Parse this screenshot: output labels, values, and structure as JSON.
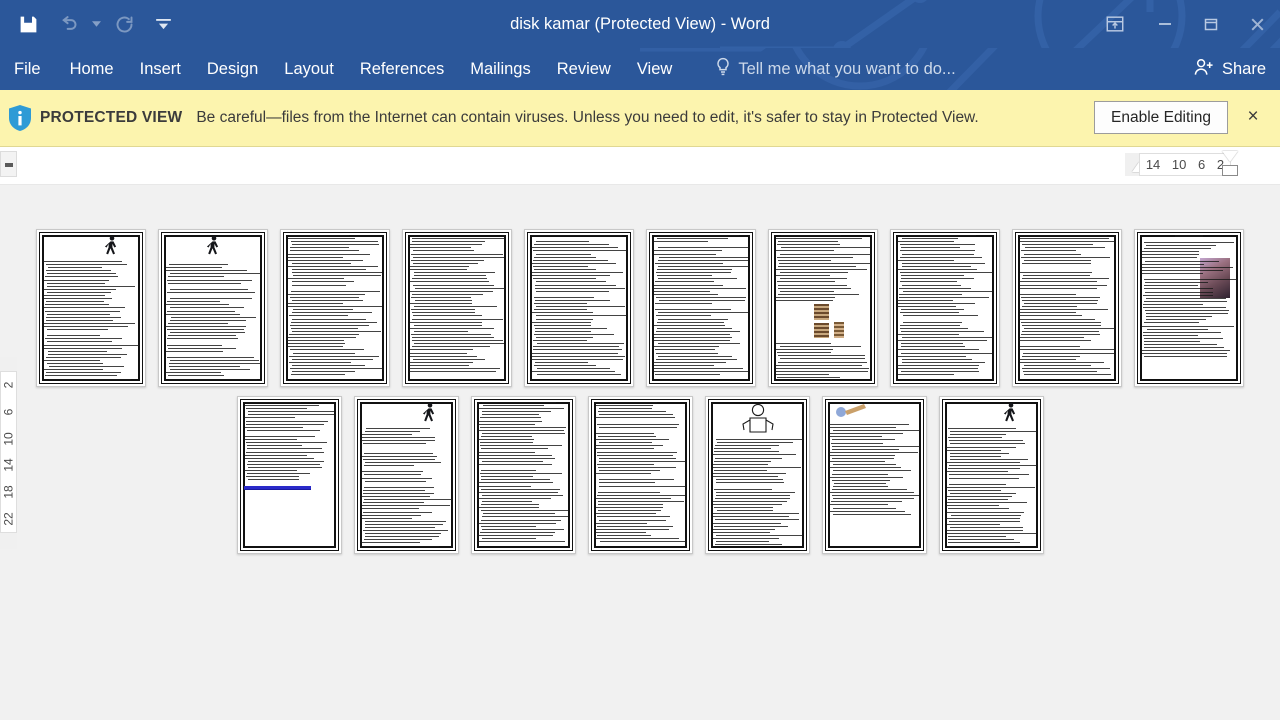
{
  "window": {
    "title": "disk kamar (Protected View) - Word",
    "quick_access": [
      {
        "name": "save-icon",
        "label": "Save",
        "enabled": true
      },
      {
        "name": "undo-icon",
        "label": "Undo",
        "enabled": false
      },
      {
        "name": "redo-icon",
        "label": "Redo",
        "enabled": false
      },
      {
        "name": "customize-quick-access-icon",
        "label": "Customize Quick Access Toolbar",
        "enabled": true
      }
    ],
    "controls": [
      {
        "name": "ribbon-display-options-icon",
        "label": "Ribbon Display Options"
      },
      {
        "name": "minimize-icon",
        "label": "Minimize"
      },
      {
        "name": "restore-icon",
        "label": "Restore Down"
      },
      {
        "name": "close-icon",
        "label": "Close"
      }
    ]
  },
  "ribbon": {
    "tabs": [
      {
        "label": "File"
      },
      {
        "label": "Home"
      },
      {
        "label": "Insert"
      },
      {
        "label": "Design"
      },
      {
        "label": "Layout"
      },
      {
        "label": "References"
      },
      {
        "label": "Mailings"
      },
      {
        "label": "Review"
      },
      {
        "label": "View"
      }
    ],
    "tell_me_placeholder": "Tell me what you want to do...",
    "share_label": "Share"
  },
  "protected_view": {
    "label": "PROTECTED VIEW",
    "message": "Be careful—files from the Internet can contain viruses. Unless you need to edit, it's safer to stay in Protected",
    "message_line2": "View.",
    "enable_button": "Enable Editing",
    "close_label": "×",
    "info_icon": "shield-info-icon",
    "bg_color": "#fcf4ae"
  },
  "rulers": {
    "horizontal_ticks": [
      "14",
      "10",
      "6",
      "2"
    ],
    "vertical_ticks": [
      "2",
      "6",
      "10",
      "14",
      "18",
      "22"
    ]
  },
  "theme": {
    "titlebar": "#2b579a",
    "canvas": "#f1f1f1",
    "accent": "#2b579a",
    "link": "#2a2aca"
  },
  "document": {
    "zoom_view": "multiple-pages",
    "row1_pages": [
      {
        "page": 1,
        "art": "horse-illustration"
      },
      {
        "page": 2,
        "art": "figure-illustration"
      },
      {
        "page": 3,
        "art": "none"
      },
      {
        "page": 4,
        "art": "none"
      },
      {
        "page": 5,
        "art": "none"
      },
      {
        "page": 6,
        "art": "none"
      },
      {
        "page": 7,
        "art": "spine-diagram"
      },
      {
        "page": 8,
        "art": "none"
      },
      {
        "page": 9,
        "art": "none"
      },
      {
        "page": 10,
        "art": "back-pain-photo"
      }
    ],
    "row2_pages": [
      {
        "page": 11,
        "art": "hyperlink"
      },
      {
        "page": 12,
        "art": "running-figure"
      },
      {
        "page": 13,
        "art": "none"
      },
      {
        "page": 14,
        "art": "none"
      },
      {
        "page": 15,
        "art": "exercise-figure"
      },
      {
        "page": 16,
        "art": "exercise-tool"
      },
      {
        "page": 17,
        "art": "head-neck-illustration"
      }
    ]
  }
}
